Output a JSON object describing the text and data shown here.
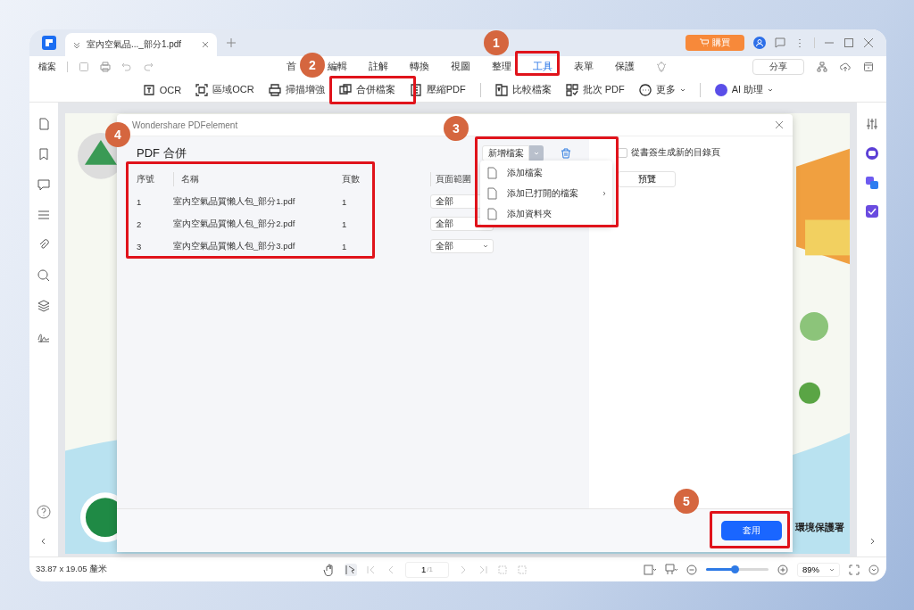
{
  "tab": {
    "title": "室內空氣品..._部分1.pdf"
  },
  "buy_button": "購買",
  "file_menu": "檔案",
  "menu": [
    {
      "label": "首",
      "selected": false
    },
    {
      "label": "編輯",
      "selected": false
    },
    {
      "label": "註解",
      "selected": false
    },
    {
      "label": "轉換",
      "selected": false
    },
    {
      "label": "視圖",
      "selected": false
    },
    {
      "label": "整理",
      "selected": false
    },
    {
      "label": "工具",
      "selected": true
    },
    {
      "label": "表單",
      "selected": false
    },
    {
      "label": "保護",
      "selected": false
    }
  ],
  "share_button": "分享",
  "toolbar": [
    {
      "label": "OCR",
      "kind": "ocr",
      "dropdown": false,
      "separator_after": false
    },
    {
      "label": "區域OCR",
      "kind": "area-ocr",
      "dropdown": false,
      "separator_after": false
    },
    {
      "label": "掃描增強",
      "kind": "scan",
      "dropdown": false,
      "separator_after": false
    },
    {
      "label": "合併檔案",
      "kind": "merge",
      "dropdown": false,
      "separator_after": false
    },
    {
      "label": "壓縮PDF",
      "kind": "compress",
      "dropdown": false,
      "separator_after": true
    },
    {
      "label": "比較檔案",
      "kind": "compare",
      "dropdown": false,
      "separator_after": false
    },
    {
      "label": "批次 PDF",
      "kind": "batch",
      "dropdown": false,
      "separator_after": false
    },
    {
      "label": "更多",
      "kind": "more",
      "dropdown": true,
      "separator_after": true
    },
    {
      "label": "AI 助理",
      "kind": "ai",
      "dropdown": true,
      "separator_after": false
    }
  ],
  "dialog": {
    "app_name": "Wondershare PDFelement",
    "title": "PDF 合併",
    "columns": [
      "序號",
      "名稱",
      "頁數",
      "頁面範圍"
    ],
    "rows": [
      {
        "index": "1",
        "name": "室內空氣品質懶人包_部分1.pdf",
        "pages": "1",
        "range": "全部"
      },
      {
        "index": "2",
        "name": "室內空氣品質懶人包_部分2.pdf",
        "pages": "1",
        "range": "全部"
      },
      {
        "index": "3",
        "name": "室內空氣品質懶人包_部分3.pdf",
        "pages": "1",
        "range": "全部"
      }
    ],
    "add_button": "新增檔案",
    "add_menu": [
      {
        "label": "添加檔案",
        "submenu": false
      },
      {
        "label": "添加已打開的檔案",
        "submenu": true
      },
      {
        "label": "添加資料夾",
        "submenu": false
      }
    ],
    "bookmark_option": {
      "label": "從書簽生成新的目錄頁",
      "checked": false
    },
    "preview_button": "預覽",
    "apply_button": "套用"
  },
  "page_text": "環境保護署",
  "status": {
    "size": "33.87 x 19.05 釐米",
    "page": "1",
    "page_total": "/1",
    "zoom": "89%",
    "zoom_slider": {
      "level": 0.45
    }
  },
  "annotations": [
    "1",
    "2",
    "3",
    "4",
    "5"
  ]
}
